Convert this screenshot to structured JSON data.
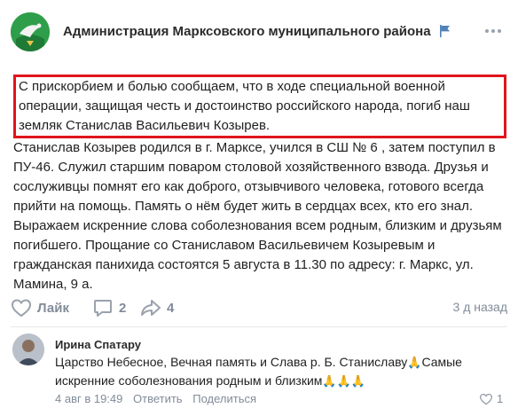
{
  "post": {
    "group_name": "Администрация Марксовского муниципального района",
    "highlight_text": "С прискорбием и болью сообщаем, что в ходе специальной военной операции, защищая честь и достоинство российского народа, погиб наш земляк Станислав Васильевич Козырев.",
    "body_text": "Станислав Козырев родился в г. Марксе, учился в СШ № 6 , затем поступил в ПУ-46. Служил старшим поваром столовой хозяйственного взвода. Друзья и сослуживцы помнят его как доброго, отзывчивого человека, готового всегда прийти на помощь. Память о нём будет жить в сердцах всех, кто его знал. Выражаем искренние слова соболезнования всем родным, близким и друзьям погибшего. Прощание со Станиславом Васильевичем Козыревым и гражданская панихида состоятся 5 августа в 11.30 по адресу: г. Маркс, ул. Мамина, 9 а.",
    "like_label": "Лайк",
    "comment_count": "2",
    "share_count": "4",
    "time": "3 д назад",
    "icons": {
      "flag": "flag-icon",
      "more": "more-icon",
      "like": "heart-icon",
      "comment": "comment-icon",
      "share": "share-icon"
    },
    "accent_color": "#e0151c"
  },
  "comment": {
    "author": "Ирина Спатару",
    "text_part1": "Царство Небесное, Вечная память и Слава р. Б. Станиславу",
    "text_part2": "Самые искренние соболезнования родным и близким",
    "date": "4 авг в 19:49",
    "reply_label": "Ответить",
    "share_label": "Поделиться",
    "like_count": "1",
    "icons": {
      "emoji": "praying-hands-icon",
      "like": "heart-icon"
    }
  }
}
